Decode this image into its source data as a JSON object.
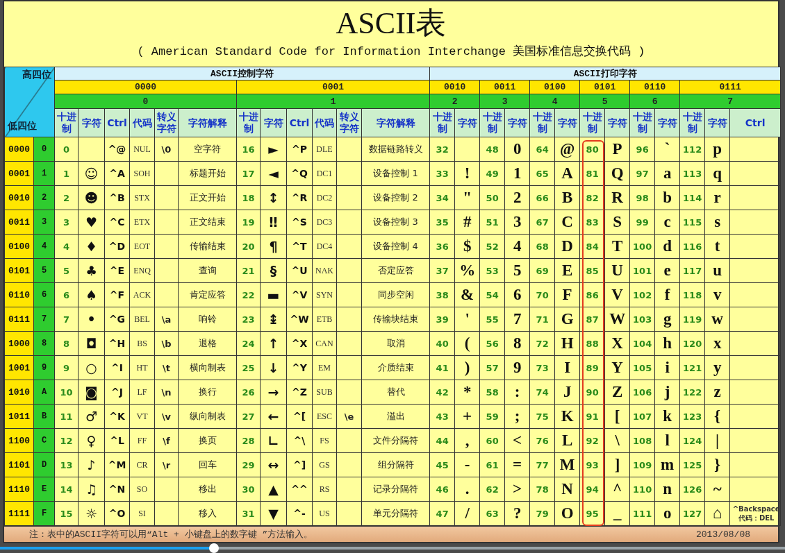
{
  "title": "ASCII表",
  "subtitle": "( American Standard Code for Information Interchange  美国标准信息交换代码 )",
  "corner": {
    "high": "高四位",
    "low": "低四位"
  },
  "sections": [
    {
      "label": "ASCII控制字符",
      "kind": "control"
    },
    {
      "label": "ASCII打印字符",
      "kind": "print"
    }
  ],
  "groups": [
    {
      "bits": "0000",
      "hex": "0",
      "kind": "control",
      "highlighted": false,
      "columns": [
        "十进制",
        "字符",
        "Ctrl",
        "代码",
        "转义字符",
        "字符解释"
      ]
    },
    {
      "bits": "0001",
      "hex": "1",
      "kind": "control",
      "highlighted": false,
      "columns": [
        "十进制",
        "字符",
        "Ctrl",
        "代码",
        "转义字符",
        "字符解释"
      ]
    },
    {
      "bits": "0010",
      "hex": "2",
      "kind": "print",
      "highlighted": false,
      "columns": [
        "十进制",
        "字符"
      ]
    },
    {
      "bits": "0011",
      "hex": "3",
      "kind": "print",
      "highlighted": false,
      "columns": [
        "十进制",
        "字符"
      ]
    },
    {
      "bits": "0100",
      "hex": "4",
      "kind": "print",
      "highlighted": false,
      "columns": [
        "十进制",
        "字符"
      ]
    },
    {
      "bits": "0101",
      "hex": "5",
      "kind": "print",
      "highlighted": true,
      "columns": [
        "十进制",
        "字符"
      ]
    },
    {
      "bits": "0110",
      "hex": "6",
      "kind": "print",
      "highlighted": false,
      "columns": [
        "十进制",
        "字符"
      ]
    },
    {
      "bits": "0111",
      "hex": "7",
      "kind": "print",
      "highlighted": false,
      "columns": [
        "十进制",
        "字符",
        "Ctrl"
      ]
    }
  ],
  "rows": [
    {
      "bits": "0000",
      "hex": "0",
      "cells": [
        {
          "dec": "0",
          "ctrl": "^@",
          "code": "NUL",
          "esc": "\\0",
          "desc": "空字符"
        },
        {
          "dec": "16",
          "char": "►",
          "ctrl": "^P",
          "code": "DLE",
          "desc": "数据链路转义"
        },
        {
          "dec": "32"
        },
        {
          "dec": "48",
          "char": "0"
        },
        {
          "dec": "64",
          "char": "@"
        },
        {
          "dec": "80",
          "char": "P"
        },
        {
          "dec": "96",
          "char": "`"
        },
        {
          "dec": "112",
          "char": "p"
        }
      ]
    },
    {
      "bits": "0001",
      "hex": "1",
      "cells": [
        {
          "dec": "1",
          "char": "☺",
          "ctrl": "^A",
          "code": "SOH",
          "desc": "标题开始"
        },
        {
          "dec": "17",
          "char": "◄",
          "ctrl": "^Q",
          "code": "DC1",
          "desc": "设备控制 1"
        },
        {
          "dec": "33",
          "char": "!"
        },
        {
          "dec": "49",
          "char": "1"
        },
        {
          "dec": "65",
          "char": "A"
        },
        {
          "dec": "81",
          "char": "Q"
        },
        {
          "dec": "97",
          "char": "a"
        },
        {
          "dec": "113",
          "char": "q"
        }
      ]
    },
    {
      "bits": "0010",
      "hex": "2",
      "cells": [
        {
          "dec": "2",
          "char": "☻",
          "ctrl": "^B",
          "code": "STX",
          "desc": "正文开始"
        },
        {
          "dec": "18",
          "char": "↕",
          "ctrl": "^R",
          "code": "DC2",
          "desc": "设备控制 2"
        },
        {
          "dec": "34",
          "char": "\""
        },
        {
          "dec": "50",
          "char": "2"
        },
        {
          "dec": "66",
          "char": "B"
        },
        {
          "dec": "82",
          "char": "R"
        },
        {
          "dec": "98",
          "char": "b"
        },
        {
          "dec": "114",
          "char": "r"
        }
      ]
    },
    {
      "bits": "0011",
      "hex": "3",
      "cells": [
        {
          "dec": "3",
          "char": "♥",
          "ctrl": "^C",
          "code": "ETX",
          "desc": "正文结束"
        },
        {
          "dec": "19",
          "char": "‼",
          "ctrl": "^S",
          "code": "DC3",
          "desc": "设备控制 3"
        },
        {
          "dec": "35",
          "char": "#"
        },
        {
          "dec": "51",
          "char": "3"
        },
        {
          "dec": "67",
          "char": "C"
        },
        {
          "dec": "83",
          "char": "S"
        },
        {
          "dec": "99",
          "char": "c"
        },
        {
          "dec": "115",
          "char": "s"
        }
      ]
    },
    {
      "bits": "0100",
      "hex": "4",
      "cells": [
        {
          "dec": "4",
          "char": "♦",
          "ctrl": "^D",
          "code": "EOT",
          "desc": "传输结束"
        },
        {
          "dec": "20",
          "char": "¶",
          "ctrl": "^T",
          "code": "DC4",
          "desc": "设备控制 4"
        },
        {
          "dec": "36",
          "char": "$"
        },
        {
          "dec": "52",
          "char": "4"
        },
        {
          "dec": "68",
          "char": "D"
        },
        {
          "dec": "84",
          "char": "T"
        },
        {
          "dec": "100",
          "char": "d"
        },
        {
          "dec": "116",
          "char": "t"
        }
      ]
    },
    {
      "bits": "0101",
      "hex": "5",
      "cells": [
        {
          "dec": "5",
          "char": "♣",
          "ctrl": "^E",
          "code": "ENQ",
          "desc": "查询"
        },
        {
          "dec": "21",
          "char": "§",
          "ctrl": "^U",
          "code": "NAK",
          "desc": "否定应答"
        },
        {
          "dec": "37",
          "char": "%"
        },
        {
          "dec": "53",
          "char": "5"
        },
        {
          "dec": "69",
          "char": "E"
        },
        {
          "dec": "85",
          "char": "U"
        },
        {
          "dec": "101",
          "char": "e"
        },
        {
          "dec": "117",
          "char": "u"
        }
      ]
    },
    {
      "bits": "0110",
      "hex": "6",
      "cells": [
        {
          "dec": "6",
          "char": "♠",
          "ctrl": "^F",
          "code": "ACK",
          "desc": "肯定应答"
        },
        {
          "dec": "22",
          "char": "▬",
          "ctrl": "^V",
          "code": "SYN",
          "desc": "同步空闲"
        },
        {
          "dec": "38",
          "char": "&"
        },
        {
          "dec": "54",
          "char": "6"
        },
        {
          "dec": "70",
          "char": "F"
        },
        {
          "dec": "86",
          "char": "V"
        },
        {
          "dec": "102",
          "char": "f"
        },
        {
          "dec": "118",
          "char": "v"
        }
      ]
    },
    {
      "bits": "0111",
      "hex": "7",
      "cells": [
        {
          "dec": "7",
          "char": "•",
          "ctrl": "^G",
          "code": "BEL",
          "esc": "\\a",
          "desc": "响铃"
        },
        {
          "dec": "23",
          "char": "↨",
          "ctrl": "^W",
          "code": "ETB",
          "desc": "传输块结束"
        },
        {
          "dec": "39",
          "char": "'"
        },
        {
          "dec": "55",
          "char": "7"
        },
        {
          "dec": "71",
          "char": "G"
        },
        {
          "dec": "87",
          "char": "W"
        },
        {
          "dec": "103",
          "char": "g"
        },
        {
          "dec": "119",
          "char": "w"
        }
      ]
    },
    {
      "bits": "1000",
      "hex": "8",
      "cells": [
        {
          "dec": "8",
          "char": "◘",
          "ctrl": "^H",
          "code": "BS",
          "esc": "\\b",
          "desc": "退格"
        },
        {
          "dec": "24",
          "char": "↑",
          "ctrl": "^X",
          "code": "CAN",
          "desc": "取消"
        },
        {
          "dec": "40",
          "char": "("
        },
        {
          "dec": "56",
          "char": "8"
        },
        {
          "dec": "72",
          "char": "H"
        },
        {
          "dec": "88",
          "char": "X"
        },
        {
          "dec": "104",
          "char": "h"
        },
        {
          "dec": "120",
          "char": "x"
        }
      ]
    },
    {
      "bits": "1001",
      "hex": "9",
      "cells": [
        {
          "dec": "9",
          "char": "○",
          "ctrl": "^I",
          "code": "HT",
          "esc": "\\t",
          "desc": "横向制表"
        },
        {
          "dec": "25",
          "char": "↓",
          "ctrl": "^Y",
          "code": "EM",
          "desc": "介质结束"
        },
        {
          "dec": "41",
          "char": ")"
        },
        {
          "dec": "57",
          "char": "9"
        },
        {
          "dec": "73",
          "char": "I"
        },
        {
          "dec": "89",
          "char": "Y"
        },
        {
          "dec": "105",
          "char": "i"
        },
        {
          "dec": "121",
          "char": "y"
        }
      ]
    },
    {
      "bits": "1010",
      "hex": "A",
      "cells": [
        {
          "dec": "10",
          "char": "◙",
          "ctrl": "^J",
          "code": "LF",
          "esc": "\\n",
          "desc": "换行"
        },
        {
          "dec": "26",
          "char": "→",
          "ctrl": "^Z",
          "code": "SUB",
          "desc": "替代"
        },
        {
          "dec": "42",
          "char": "*"
        },
        {
          "dec": "58",
          "char": ":"
        },
        {
          "dec": "74",
          "char": "J"
        },
        {
          "dec": "90",
          "char": "Z"
        },
        {
          "dec": "106",
          "char": "j"
        },
        {
          "dec": "122",
          "char": "z"
        }
      ]
    },
    {
      "bits": "1011",
      "hex": "B",
      "cells": [
        {
          "dec": "11",
          "char": "♂",
          "ctrl": "^K",
          "code": "VT",
          "esc": "\\v",
          "desc": "纵向制表"
        },
        {
          "dec": "27",
          "char": "←",
          "ctrl": "^[",
          "code": "ESC",
          "esc": "\\e",
          "desc": "溢出"
        },
        {
          "dec": "43",
          "char": "+"
        },
        {
          "dec": "59",
          "char": ";"
        },
        {
          "dec": "75",
          "char": "K"
        },
        {
          "dec": "91",
          "char": "["
        },
        {
          "dec": "107",
          "char": "k"
        },
        {
          "dec": "123",
          "char": "{"
        }
      ]
    },
    {
      "bits": "1100",
      "hex": "C",
      "cells": [
        {
          "dec": "12",
          "char": "♀",
          "ctrl": "^L",
          "code": "FF",
          "esc": "\\f",
          "desc": "换页"
        },
        {
          "dec": "28",
          "char": "∟",
          "ctrl": "^\\",
          "code": "FS",
          "desc": "文件分隔符"
        },
        {
          "dec": "44",
          "char": ","
        },
        {
          "dec": "60",
          "char": "<"
        },
        {
          "dec": "76",
          "char": "L"
        },
        {
          "dec": "92",
          "char": "\\"
        },
        {
          "dec": "108",
          "char": "l"
        },
        {
          "dec": "124",
          "char": "|"
        }
      ]
    },
    {
      "bits": "1101",
      "hex": "D",
      "cells": [
        {
          "dec": "13",
          "char": "♪",
          "ctrl": "^M",
          "code": "CR",
          "esc": "\\r",
          "desc": "回车"
        },
        {
          "dec": "29",
          "char": "↔",
          "ctrl": "^]",
          "code": "GS",
          "desc": "组分隔符"
        },
        {
          "dec": "45",
          "char": "-"
        },
        {
          "dec": "61",
          "char": "="
        },
        {
          "dec": "77",
          "char": "M"
        },
        {
          "dec": "93",
          "char": "]"
        },
        {
          "dec": "109",
          "char": "m"
        },
        {
          "dec": "125",
          "char": "}"
        }
      ]
    },
    {
      "bits": "1110",
      "hex": "E",
      "cells": [
        {
          "dec": "14",
          "char": "♫",
          "ctrl": "^N",
          "code": "SO",
          "desc": "移出"
        },
        {
          "dec": "30",
          "char": "▲",
          "ctrl": "^^",
          "code": "RS",
          "desc": "记录分隔符"
        },
        {
          "dec": "46",
          "char": "."
        },
        {
          "dec": "62",
          "char": ">"
        },
        {
          "dec": "78",
          "char": "N"
        },
        {
          "dec": "94",
          "char": "^"
        },
        {
          "dec": "110",
          "char": "n"
        },
        {
          "dec": "126",
          "char": "~"
        }
      ]
    },
    {
      "bits": "1111",
      "hex": "F",
      "cells": [
        {
          "dec": "15",
          "char": "☼",
          "ctrl": "^O",
          "code": "SI",
          "desc": "移入"
        },
        {
          "dec": "31",
          "char": "▼",
          "ctrl": "^-",
          "code": "US",
          "desc": "单元分隔符"
        },
        {
          "dec": "47",
          "char": "/"
        },
        {
          "dec": "63",
          "char": "?"
        },
        {
          "dec": "79",
          "char": "O"
        },
        {
          "dec": "95",
          "char": "_"
        },
        {
          "dec": "111",
          "char": "o"
        },
        {
          "dec": "127",
          "char": "⌂",
          "ctrl": [
            "^Backspace",
            "代码：DEL"
          ]
        }
      ]
    }
  ],
  "footer": {
    "note": "注：表中的ASCII字符可以用“Alt + 小键盘上的数字键 ”方法输入。",
    "date": "2013/08/08"
  },
  "progress": {
    "level": 0.273
  }
}
